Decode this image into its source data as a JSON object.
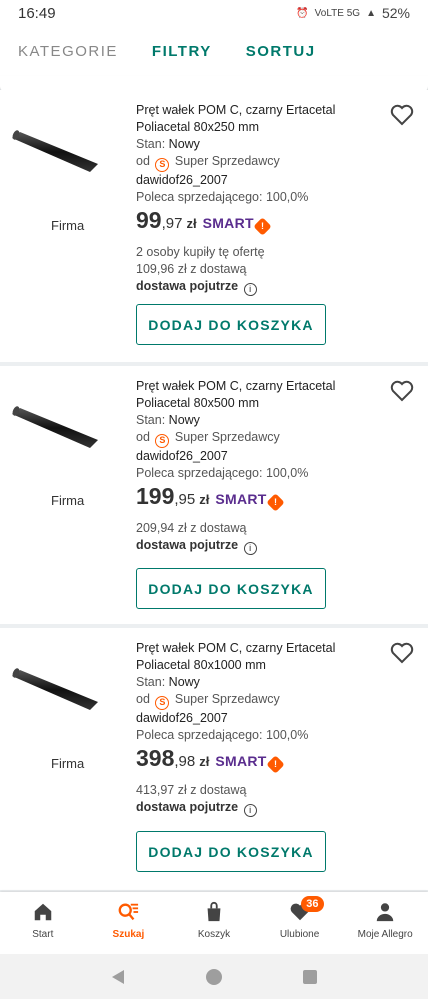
{
  "status_bar": {
    "time": "16:49",
    "network": "VoLTE 5G",
    "battery": "52%"
  },
  "tabs": [
    {
      "label": "KATEGORIE"
    },
    {
      "label": "FILTRY"
    },
    {
      "label": "SORTUJ"
    }
  ],
  "listings": [
    {
      "title": "Pręt wałek POM C, czarny Ertacetal Poliacetal 80x250 mm",
      "condition_label": "Stan:",
      "condition": "Nowy",
      "from_label": "od",
      "seller_type": "Super Sprzedawcy",
      "seller": "dawidof26_2007",
      "recommend": "Poleca sprzedającego: 100,0%",
      "seller_kind": "Firma",
      "price_int": "99",
      "price_dec": ",97",
      "currency": "zł",
      "smart": "SMART",
      "buyers": "2 osoby kupiły tę ofertę",
      "delivery_price": "109,96 zł z dostawą",
      "delivery_time": "dostawa pojutrze",
      "button": "DODAJ DO KOSZYKA"
    },
    {
      "title": "Pręt wałek POM C, czarny Ertacetal Poliacetal 80x500 mm",
      "condition_label": "Stan:",
      "condition": "Nowy",
      "from_label": "od",
      "seller_type": "Super Sprzedawcy",
      "seller": "dawidof26_2007",
      "recommend": "Poleca sprzedającego: 100,0%",
      "seller_kind": "Firma",
      "price_int": "199",
      "price_dec": ",95",
      "currency": "zł",
      "smart": "SMART",
      "delivery_price": "209,94 zł z dostawą",
      "delivery_time": "dostawa pojutrze",
      "button": "DODAJ DO KOSZYKA"
    },
    {
      "title": "Pręt wałek POM C, czarny Ertacetal Poliacetal 80x1000 mm",
      "condition_label": "Stan:",
      "condition": "Nowy",
      "from_label": "od",
      "seller_type": "Super Sprzedawcy",
      "seller": "dawidof26_2007",
      "recommend": "Poleca sprzedającego: 100,0%",
      "seller_kind": "Firma",
      "price_int": "398",
      "price_dec": ",98",
      "currency": "zł",
      "smart": "SMART",
      "delivery_price": "413,97 zł z dostawą",
      "delivery_time": "dostawa pojutrze",
      "button": "DODAJ DO KOSZYKA"
    }
  ],
  "bottom_nav": [
    {
      "label": "Start",
      "icon": "home-icon"
    },
    {
      "label": "Szukaj",
      "icon": "search-list-icon"
    },
    {
      "label": "Koszyk",
      "icon": "bag-icon"
    },
    {
      "label": "Ulubione",
      "icon": "heart-icon",
      "badge": "36"
    },
    {
      "label": "Moje Allegro",
      "icon": "person-icon"
    }
  ],
  "colors": {
    "accent": "#00796b",
    "brand": "#ff5a00",
    "smart": "#5a2d8e"
  }
}
